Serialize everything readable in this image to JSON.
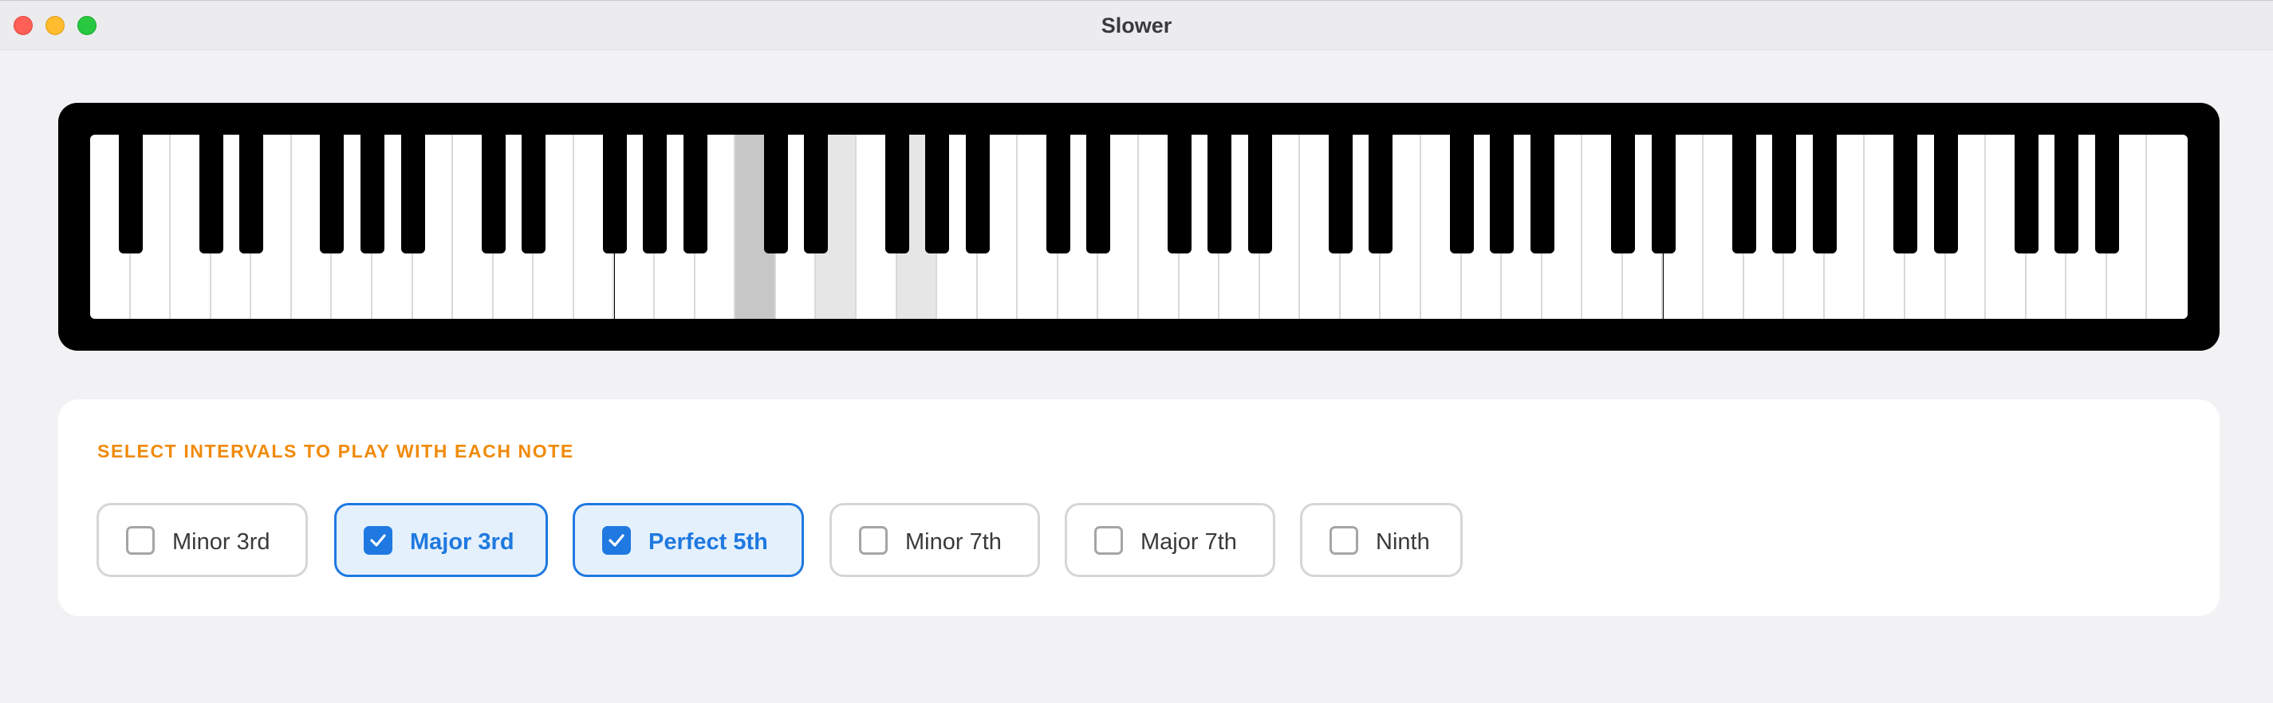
{
  "window": {
    "title": "Slower"
  },
  "piano": {
    "white_key_count": 52,
    "root_key_index": 16,
    "interval_key_indices": [
      18,
      20
    ]
  },
  "intervals": {
    "heading": "SELECT INTERVALS TO PLAY WITH EACH NOTE",
    "options": [
      {
        "label": "Minor 3rd",
        "checked": false
      },
      {
        "label": "Major 3rd",
        "checked": true
      },
      {
        "label": "Perfect 5th",
        "checked": true
      },
      {
        "label": "Minor 7th",
        "checked": false
      },
      {
        "label": "Major 7th",
        "checked": false
      },
      {
        "label": "Ninth",
        "checked": false
      }
    ]
  },
  "colors": {
    "accent": "#1f79e0",
    "heading": "#f08a0a",
    "root_key": "#c7c7c7",
    "interval_key": "#e6e6e6"
  }
}
